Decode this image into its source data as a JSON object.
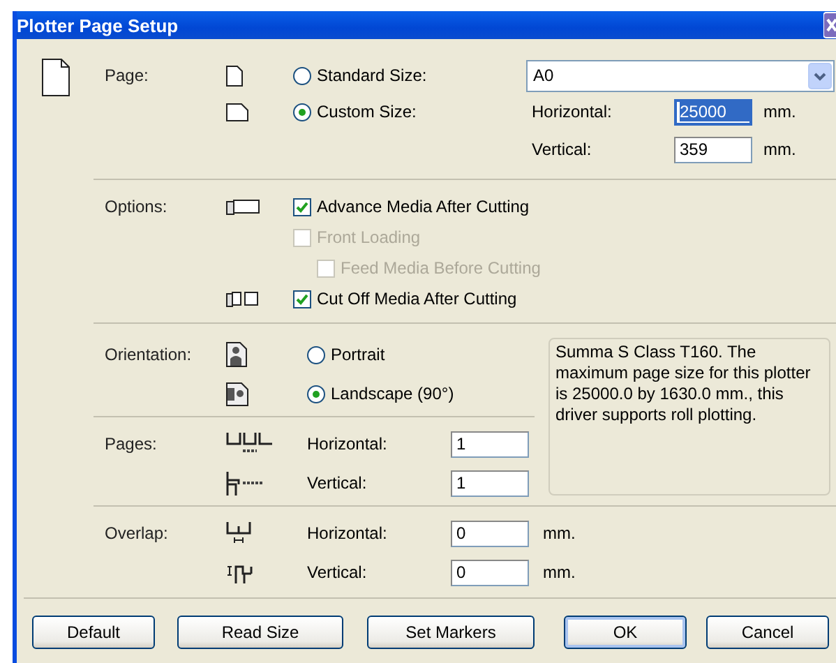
{
  "window": {
    "title": "Plotter Page Setup"
  },
  "page": {
    "label": "Page:",
    "options": [
      {
        "label": "Standard Size:",
        "selected": false
      },
      {
        "label": "Custom Size:",
        "selected": true
      }
    ],
    "standard_size": {
      "value": "A0"
    },
    "fields": [
      {
        "label": "Horizontal:",
        "value": "25000",
        "unit": "mm.",
        "focused": true
      },
      {
        "label": "Vertical:",
        "value": "359",
        "unit": "mm.",
        "focused": false
      }
    ]
  },
  "options": {
    "label": "Options:",
    "items": [
      {
        "label": "Advance Media After Cutting",
        "checked": true,
        "disabled": false
      },
      {
        "label": "Front Loading",
        "checked": false,
        "disabled": true,
        "children": [
          {
            "label": "Feed Media Before Cutting",
            "checked": false,
            "disabled": true
          }
        ]
      },
      {
        "label": "Cut Off Media After Cutting",
        "checked": true,
        "disabled": false
      }
    ]
  },
  "orientation": {
    "label": "Orientation:",
    "options": [
      {
        "label": "Portrait",
        "selected": false
      },
      {
        "label": "Landscape (90°)",
        "selected": true
      }
    ]
  },
  "info": "Summa S Class T160. The maximum page size for this plotter is 25000.0 by 1630.0 mm., this driver supports roll plotting.",
  "pages": {
    "label": "Pages:",
    "fields": [
      {
        "label": "Horizontal:",
        "value": "1"
      },
      {
        "label": "Vertical:",
        "value": "1"
      }
    ]
  },
  "overlap": {
    "label": "Overlap:",
    "fields": [
      {
        "label": "Horizontal:",
        "value": "0",
        "unit": "mm."
      },
      {
        "label": "Vertical:",
        "value": "0",
        "unit": "mm."
      }
    ]
  },
  "buttons": [
    {
      "label": "Default",
      "default": false
    },
    {
      "label": "Read Size",
      "default": false
    },
    {
      "label": "Set Markers",
      "default": false
    },
    {
      "label": "OK",
      "default": true
    },
    {
      "label": "Cancel",
      "default": false
    }
  ]
}
